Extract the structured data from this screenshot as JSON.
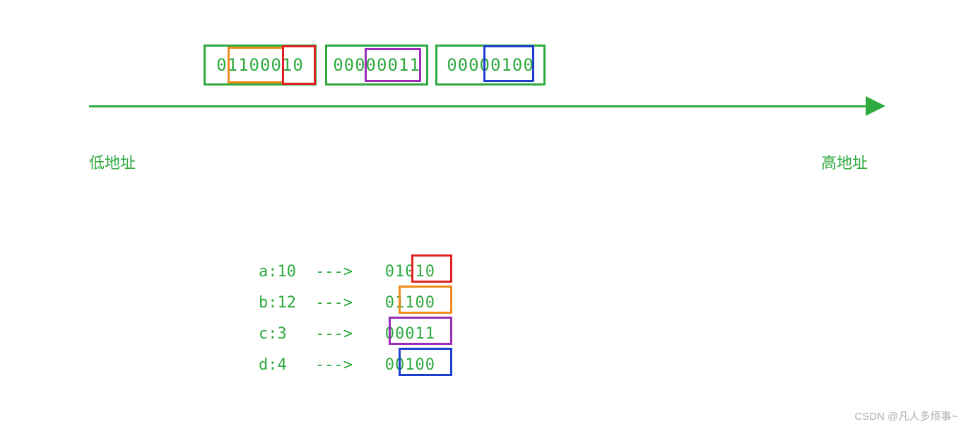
{
  "bytes": {
    "b0": "01100010",
    "b1": "00000011",
    "b2": "00000100"
  },
  "labels": {
    "low": "低地址",
    "high": "高地址"
  },
  "arrow_symbol": "--->",
  "vars": {
    "a": {
      "label": "a:10",
      "bin": "01010"
    },
    "b": {
      "label": "b:12",
      "bin": "01100"
    },
    "c": {
      "label": "c:3",
      "bin": "00011"
    },
    "d": {
      "label": "d:4",
      "bin": "00100"
    }
  },
  "watermark": "CSDN @凡人多烦事~",
  "colors": {
    "green": "#2eaa3f",
    "red": "#e02020",
    "orange": "#f08a1d",
    "purple": "#9a2fb5",
    "blue": "#1d3fd0"
  }
}
